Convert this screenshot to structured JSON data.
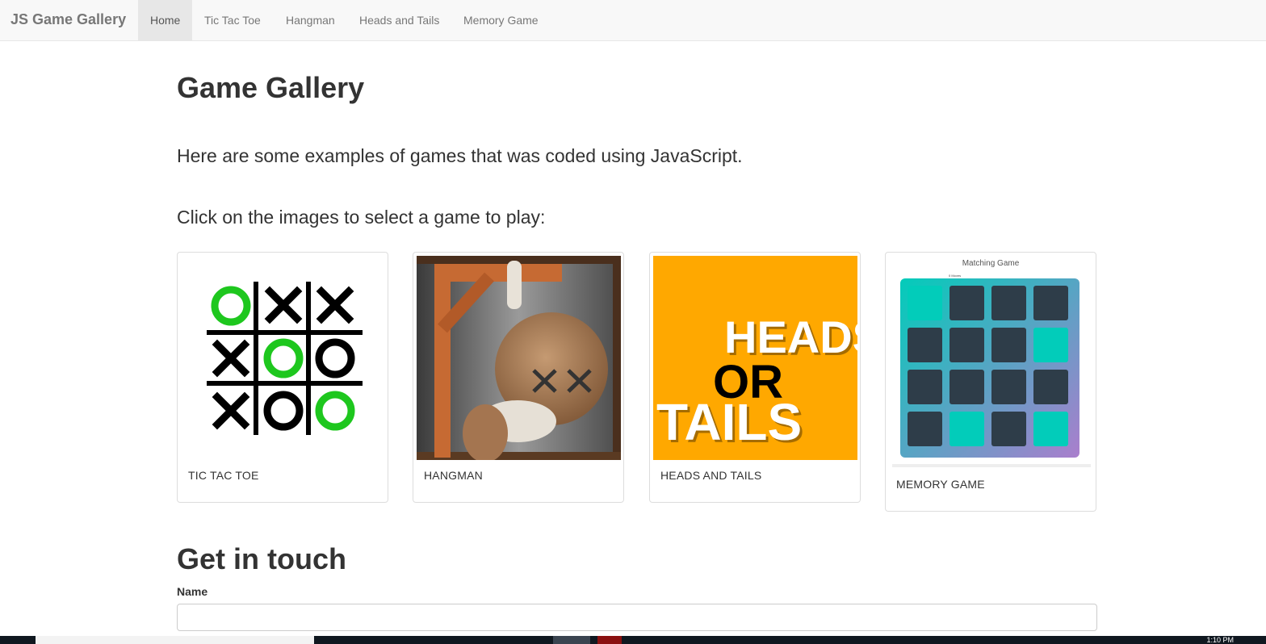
{
  "navbar": {
    "brand": "JS Game Gallery",
    "items": [
      {
        "label": "Home",
        "active": true
      },
      {
        "label": "Tic Tac Toe",
        "active": false
      },
      {
        "label": "Hangman",
        "active": false
      },
      {
        "label": "Heads and Tails",
        "active": false
      },
      {
        "label": "Memory Game",
        "active": false
      }
    ]
  },
  "main": {
    "title": "Game Gallery",
    "intro": "Here are some examples of games that was coded using JavaScript.",
    "prompt": "Click on the images to select a game to play:",
    "games": [
      {
        "caption": "TIC TAC TOE",
        "image": "tic-tac-toe-board"
      },
      {
        "caption": "HANGMAN",
        "image": "hangman-figure"
      },
      {
        "caption": "HEADS AND TAILS",
        "image": "heads-or-tails-art",
        "art_text": {
          "line1": "HEADS",
          "line2": "OR",
          "line3": "TAILS"
        }
      },
      {
        "caption": "MEMORY GAME",
        "image": "matching-game-screenshot",
        "art_text": {
          "title": "Matching Game",
          "moves": "0 Moves"
        }
      }
    ]
  },
  "contact": {
    "title": "Get in touch",
    "name_label": "Name",
    "name_value": ""
  },
  "taskbar": {
    "clock": "1:10 PM"
  },
  "colors": {
    "ttt_green": "#1ec71e",
    "heads_tails_orange": "#ffa800",
    "memory_teal": "#02ccba",
    "memory_card": "#2e3d49"
  }
}
